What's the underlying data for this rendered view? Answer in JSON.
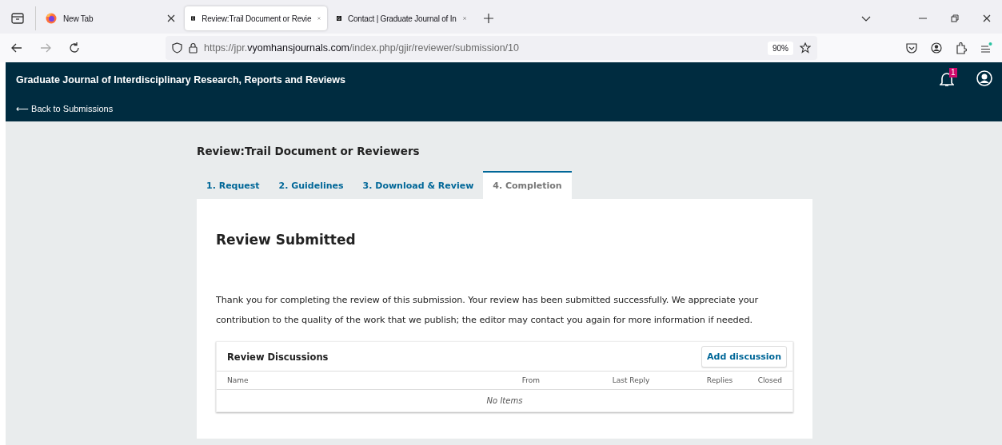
{
  "browser": {
    "tabs": [
      {
        "title": "New Tab",
        "selected": false
      },
      {
        "title": "Review:Trail Document or Revie",
        "selected": true
      },
      {
        "title": "Contact | Graduate Journal of In",
        "selected": false
      }
    ],
    "url": {
      "prefix": "https://jpr.",
      "domain": "vyomhansjournals.com",
      "path": "/index.php/gjir/reviewer/submission/10"
    },
    "zoom": "90%"
  },
  "header": {
    "title": "Graduate Journal of Interdisciplinary Research, Reports and Reviews",
    "back_link": "⟵ Back to Submissions",
    "notification_count": "1"
  },
  "page": {
    "title": "Review:Trail Document or Reviewers",
    "steps": [
      {
        "label": "1. Request",
        "selected": false
      },
      {
        "label": "2. Guidelines",
        "selected": false
      },
      {
        "label": "3. Download & Review",
        "selected": false
      },
      {
        "label": "4. Completion",
        "selected": true
      }
    ],
    "heading": "Review Submitted",
    "message": "Thank you for completing the review of this submission. Your review has been submitted successfully. We appreciate your contribution to the quality of the work that we publish; the editor may contact you again for more information if needed.",
    "discussions": {
      "title": "Review Discussions",
      "add_button": "Add discussion",
      "columns": [
        "Name",
        "From",
        "Last Reply",
        "Replies",
        "Closed"
      ],
      "empty": "No Items"
    }
  }
}
